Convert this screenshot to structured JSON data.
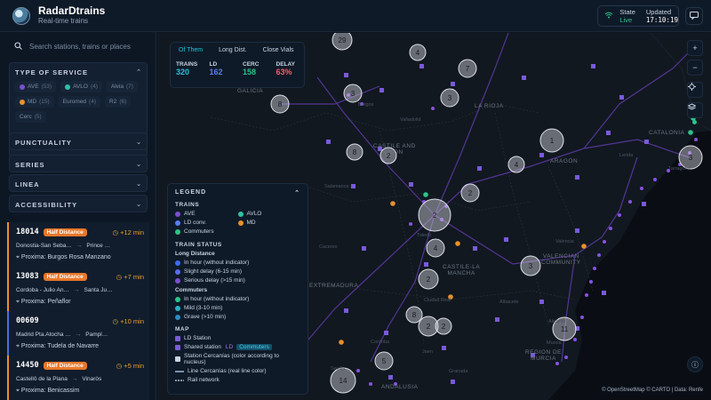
{
  "header": {
    "app_title": "RadarDtrains",
    "app_subtitle": "Real-time trains",
    "state_label": "State",
    "state_value": "Live",
    "updated_label": "Updated",
    "updated_value": "17:10:19",
    "icons": [
      "wifi-icon",
      "message-icon"
    ]
  },
  "sidebar": {
    "search_placeholder": "Search stations, trains or places",
    "type_of_service": {
      "title": "TYPE OF SERVICE",
      "chips": [
        {
          "label": "AVE",
          "count": "(53)",
          "color": "#7a4fd0"
        },
        {
          "label": "AVLO",
          "count": "(4)",
          "color": "#2cc3a6"
        },
        {
          "label": "Alvia",
          "count": "(7)",
          "color": ""
        },
        {
          "label": "MD",
          "count": "(15)",
          "color": "#e8912a"
        },
        {
          "label": "Euromed",
          "count": "(4)",
          "color": ""
        },
        {
          "label": "R2",
          "count": "(6)",
          "color": ""
        },
        {
          "label": "Cerc",
          "count": "(5)",
          "color": ""
        }
      ]
    },
    "sections": [
      "PUNCTUALITY",
      "SERIES",
      "LINEA",
      "ACCESSIBILITY"
    ],
    "trains": [
      {
        "number": "18014",
        "badge": "Half Distance",
        "delay": "+12 min",
        "from": "Donostia-San Seba…",
        "to": "Prince …",
        "next": "Proxima: Burgos Rosa Manzano"
      },
      {
        "number": "13083",
        "badge": "Half Distance",
        "delay": "+7 min",
        "from": "Cordoba - Julio An…",
        "to": "Santa Ju…",
        "next": "Proxima: Peñaflor"
      },
      {
        "number": "00609",
        "badge": "",
        "delay": "+10 min",
        "from": "Madrid Pta.Atocha …",
        "to": "Pampl…",
        "next": "Proxima: Tudela de Navarre"
      },
      {
        "number": "14450",
        "badge": "Half Distance",
        "delay": "+5 min",
        "from": "Castellô de la Plana",
        "to": "Vinaròs",
        "next": "Proxima: Benicassim"
      }
    ]
  },
  "map": {
    "tabs": [
      "Of Them",
      "Long Dist.",
      "Close Vials"
    ],
    "active_tab": "Of Them",
    "stats": [
      {
        "label": "TRAINS",
        "value": "320",
        "color": "#27c2d8"
      },
      {
        "label": "LD",
        "value": "162",
        "color": "#5a7df0"
      },
      {
        "label": "CERC",
        "value": "158",
        "color": "#2cc38a"
      },
      {
        "label": "DELAY",
        "value": "63%",
        "color": "#ff5a6a"
      }
    ],
    "regions": [
      {
        "name": "GALICIA"
      },
      {
        "name": "LA RIOJA"
      },
      {
        "name": "CATALONIA"
      },
      {
        "name": "CASTILE AND\nLEON"
      },
      {
        "name": "ARAGON"
      },
      {
        "name": "CASTILE-LA\nMANCHA"
      },
      {
        "name": "EXTREMADURA"
      },
      {
        "name": "VALENCIAN\nCOMMUNITY"
      },
      {
        "name": "REGION DE\nMURCIA"
      },
      {
        "name": "ANDALUSIA"
      }
    ],
    "cities": [
      "Burgos",
      "Valladolid",
      "Lerida",
      "Tarragona",
      "Salamanca",
      "Toledo",
      "Ciudad Real",
      "Valencia",
      "Albacete",
      "Alicante",
      "Murcia",
      "Cordoba",
      "Jaen",
      "Granada",
      "Sevilla",
      "Caceres"
    ],
    "clusters": [
      "29",
      "4",
      "7",
      "3",
      "8",
      "3",
      "1",
      "8",
      "2",
      "4",
      "2",
      "2",
      "4",
      "2",
      "3",
      "2",
      "11",
      "8",
      "2",
      "14",
      "5",
      "3"
    ],
    "attribution": "© OpenStreetMap © CARTO | Data: Renfe",
    "controls": [
      "plus-icon",
      "minus-icon",
      "locate-icon",
      "layers-icon",
      "info-icon"
    ]
  },
  "legend": {
    "title": "LEGEND",
    "trains_title": "TRAINS",
    "trains": [
      {
        "label": "AVE",
        "color": "#7a4fd0"
      },
      {
        "label": "AVLO",
        "color": "#2cc3a6"
      },
      {
        "label": "LD conv.",
        "color": "#5a7df0"
      },
      {
        "label": "MD",
        "color": "#e8912a"
      },
      {
        "label": "Commuters",
        "color": "#2cc38a"
      }
    ],
    "status_title": "TRAIN STATUS",
    "long_distance_title": "Long Distance",
    "long_distance": [
      {
        "label": "In hour (without indicator)",
        "color": "#3a6df0"
      },
      {
        "label": "Slight delay (6-15 min)",
        "color": "#5a6df0"
      },
      {
        "label": "Serious delay (>15 min)",
        "color": "#7a4fd0"
      }
    ],
    "commuters_title": "Commuters",
    "commuters": [
      {
        "label": "In hour (without indicator)",
        "color": "#2cc38a"
      },
      {
        "label": "Mild (3-10 min)",
        "color": "#2cb0c3"
      },
      {
        "label": "Grave (>10 min)",
        "color": "#2c8ac3"
      }
    ],
    "map_title": "MAP",
    "map_items": {
      "ld_station": "LD Station",
      "shared_station": "Shared station",
      "shared_ld": "LD",
      "shared_commuters": "Commuters",
      "station_cercanias": "Station Cercanías (color according to nucleus)",
      "line_cercanias": "Line Cercanías (real line color)",
      "rail_network": "Rail network"
    }
  }
}
